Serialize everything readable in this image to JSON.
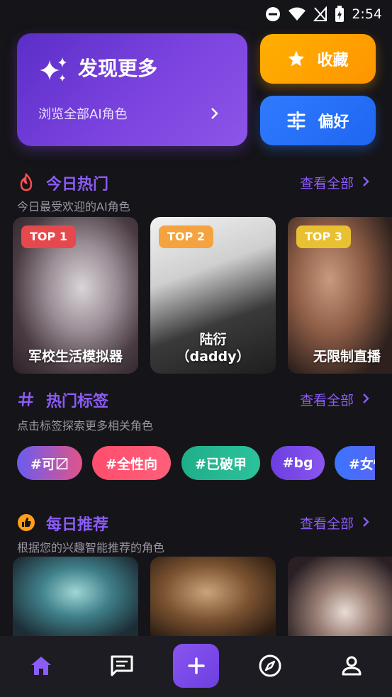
{
  "status_bar": {
    "time": "2:54"
  },
  "discover": {
    "title": "发现更多",
    "subtitle": "浏览全部AI角色"
  },
  "favorites": {
    "label": "收藏"
  },
  "preferences": {
    "label": "偏好"
  },
  "hot_today": {
    "title": "今日热门",
    "subtitle": "今日最受欢迎的AI角色",
    "see_all": "查看全部",
    "cards": [
      {
        "badge": "TOP 1",
        "name": "军校生活模拟器",
        "badge_color": "#e5484d"
      },
      {
        "badge": "TOP 2",
        "name": "陆衍（daddy）",
        "badge_color": "#f5a340"
      },
      {
        "badge": "TOP 3",
        "name": "无限制直播",
        "badge_color": "#e9c032"
      }
    ]
  },
  "hot_tags": {
    "title": "热门标签",
    "subtitle": "点击标签探索更多相关角色",
    "see_all": "查看全部",
    "tags": [
      "#可〼",
      "#全性向",
      "#已破甲",
      "#bg",
      "#女性"
    ]
  },
  "daily_recommend": {
    "title": "每日推荐",
    "subtitle": "根据您的兴趣智能推荐的角色",
    "see_all": "查看全部"
  },
  "nav": {
    "items": [
      "home-icon",
      "messages-icon",
      "add-icon",
      "explore-icon",
      "profile-icon"
    ],
    "active": "home"
  },
  "colors": {
    "accent": "#8b5cf6",
    "background": "#151418",
    "favorites": "#ff9f00",
    "preferences": "#2f7bff"
  }
}
